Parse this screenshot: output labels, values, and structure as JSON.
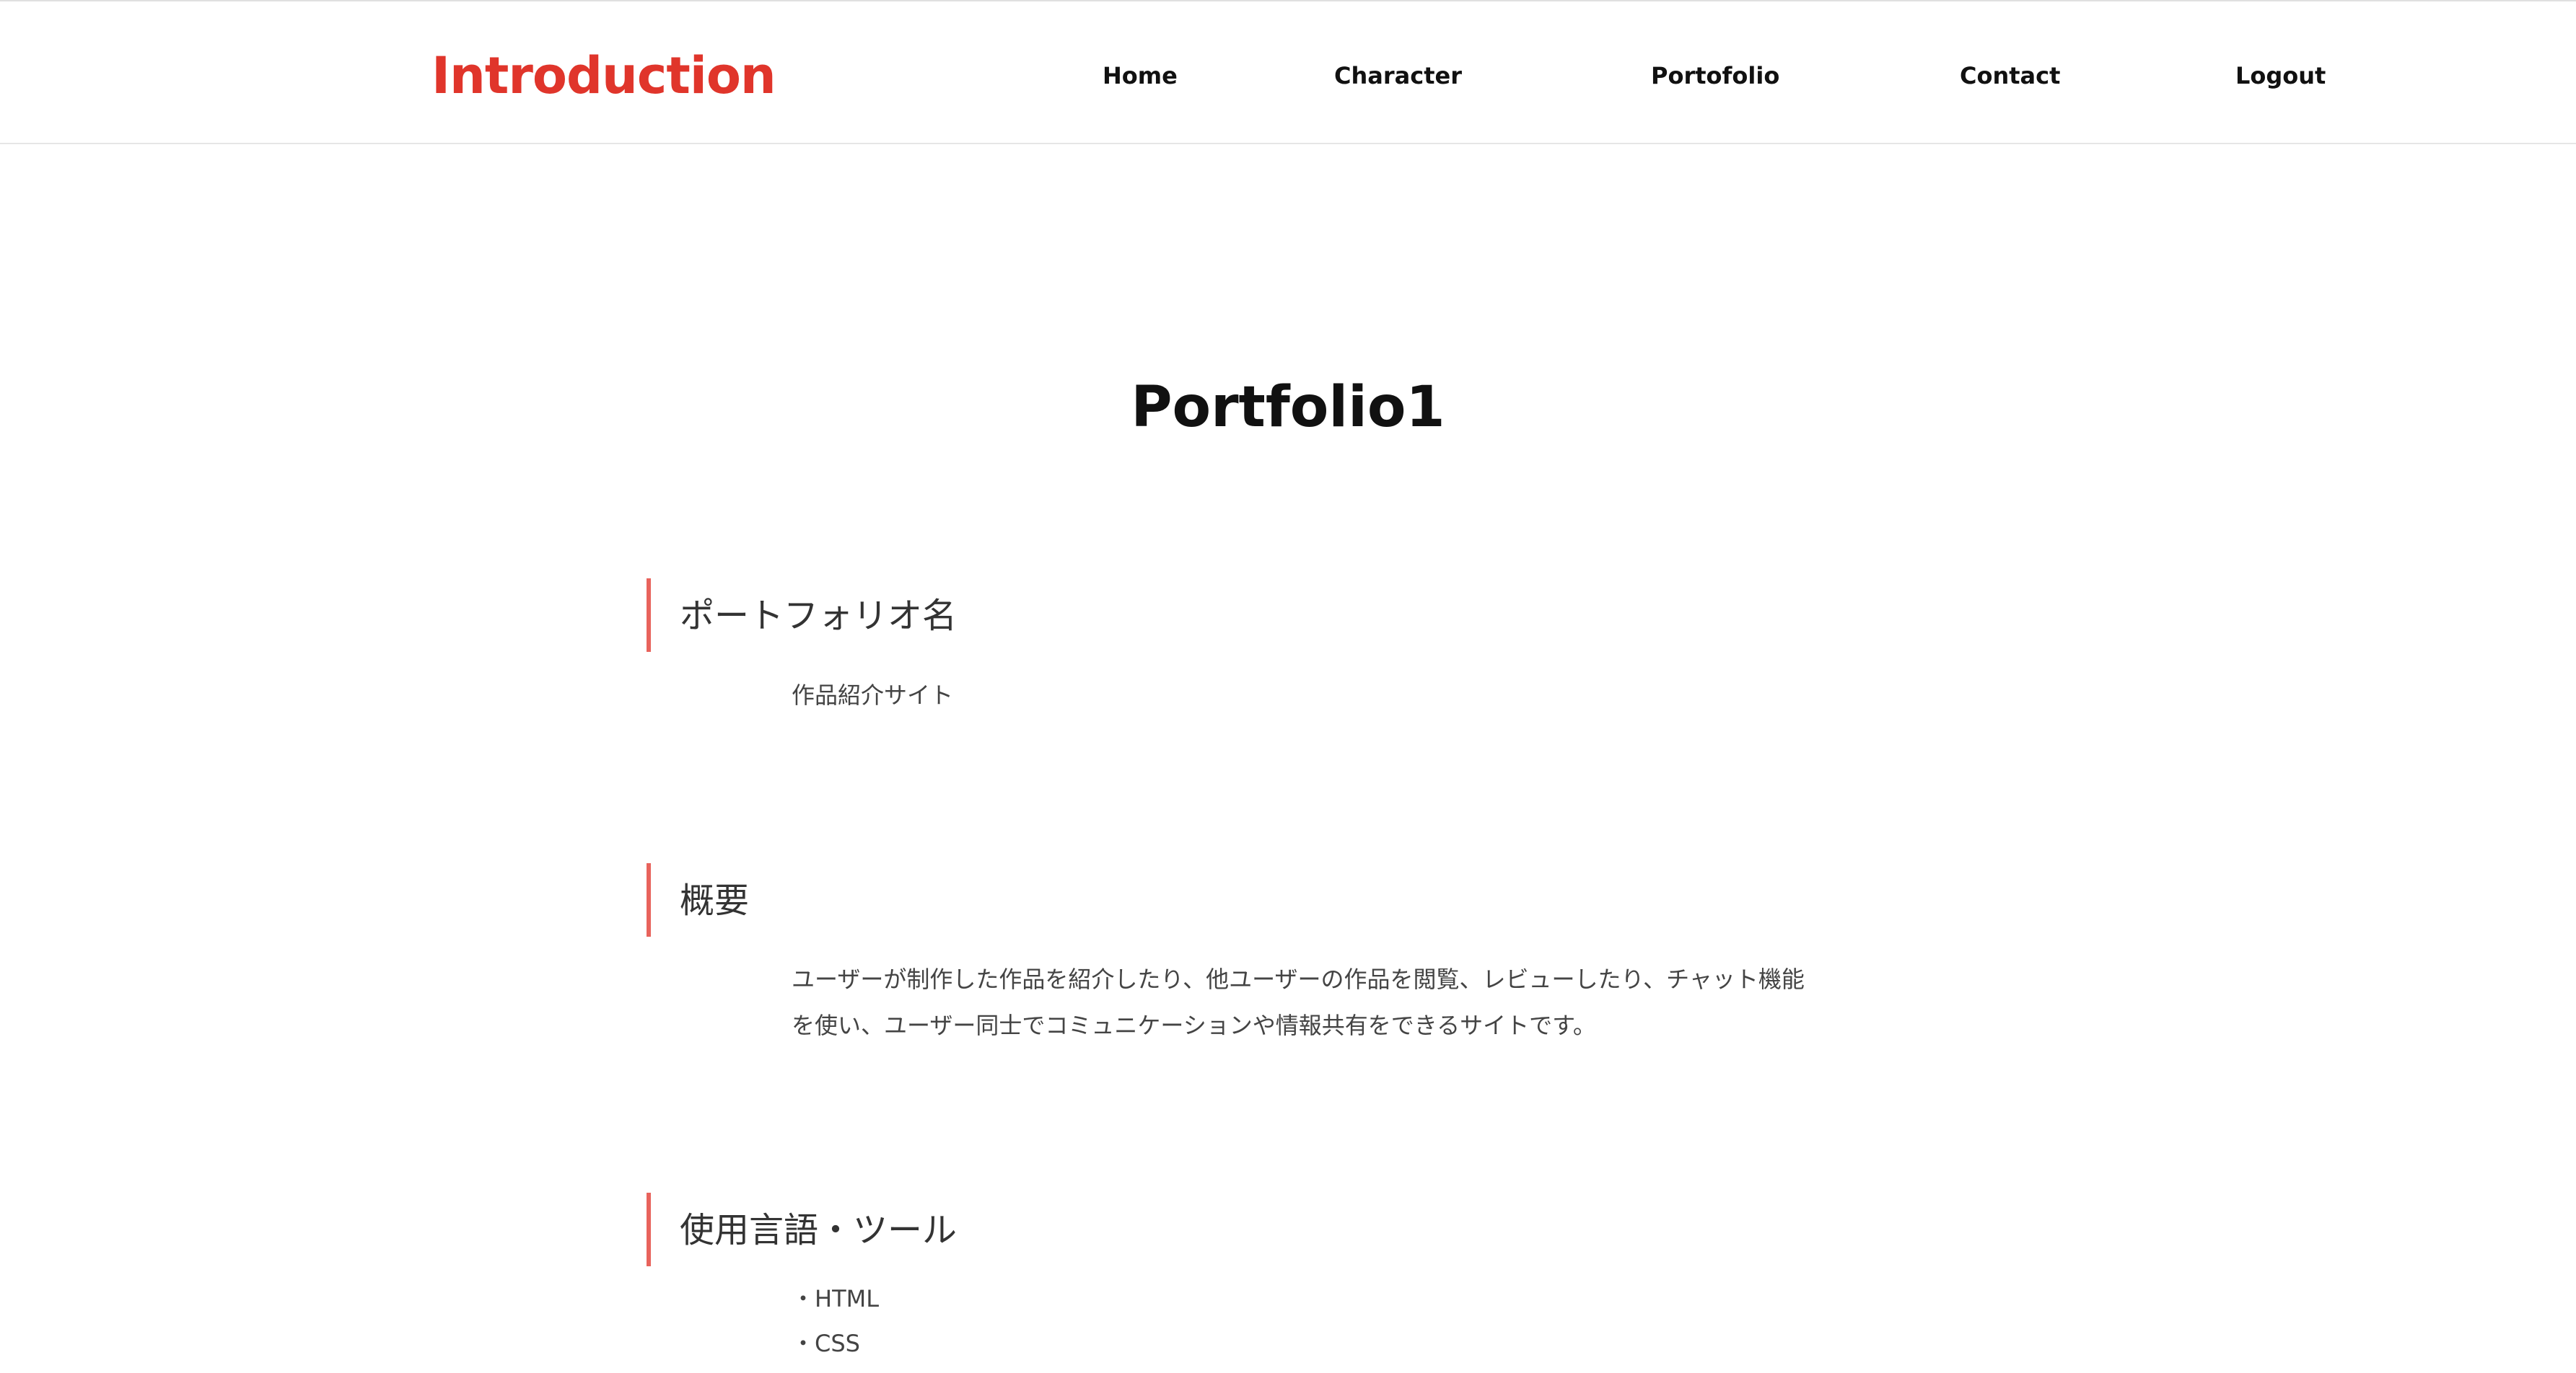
{
  "header": {
    "logo": "Introduction",
    "nav": [
      {
        "label": "Home"
      },
      {
        "label": "Character"
      },
      {
        "label": "Portofolio"
      },
      {
        "label": "Contact"
      },
      {
        "label": "Logout"
      }
    ]
  },
  "main": {
    "title": "Portfolio1",
    "sections": [
      {
        "heading": "ポートフォリオ名",
        "lines": [
          "作品紹介サイト"
        ]
      },
      {
        "heading": "概要",
        "lines": [
          "ユーザーが制作した作品を紹介したり、他ユーザーの作品を閲覧、レビューしたり、チャット機能",
          "を使い、ユーザー同士でコミュニケーションや情報共有をできるサイトです。"
        ]
      },
      {
        "heading": "使用言語・ツール",
        "lines": [
          "・HTML",
          "・CSS"
        ]
      }
    ]
  },
  "colors": {
    "brand": "#e0352b",
    "accent_bar": "#e8635c",
    "text": "#111111"
  }
}
